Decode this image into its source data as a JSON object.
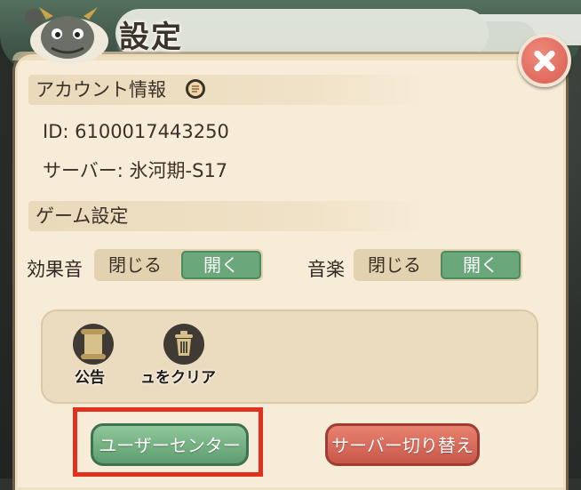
{
  "title": "設定",
  "sections": {
    "account": {
      "header": "アカウント情報",
      "id_line": "ID: 6100017443250",
      "server_line": "サーバー: 氷河期-S17"
    },
    "game": {
      "header": "ゲーム設定",
      "sound_effects": {
        "label": "効果音",
        "off": "閉じる",
        "on": "開く",
        "state": "on"
      },
      "music": {
        "label": "音楽",
        "off": "閉じる",
        "on": "開く",
        "state": "on"
      }
    }
  },
  "tools": [
    {
      "label": "公告",
      "icon": "scroll-icon"
    },
    {
      "label": "ュをクリア",
      "icon": "trash-icon"
    }
  ],
  "buttons": {
    "user_center": "ユーザーセンター",
    "switch_server": "サーバー切り替え"
  },
  "colors": {
    "panel_bg": "#f7ecd7",
    "toggle_on": "#6aa77a",
    "close_red": "#d85d50",
    "highlight": "#e0301e"
  }
}
